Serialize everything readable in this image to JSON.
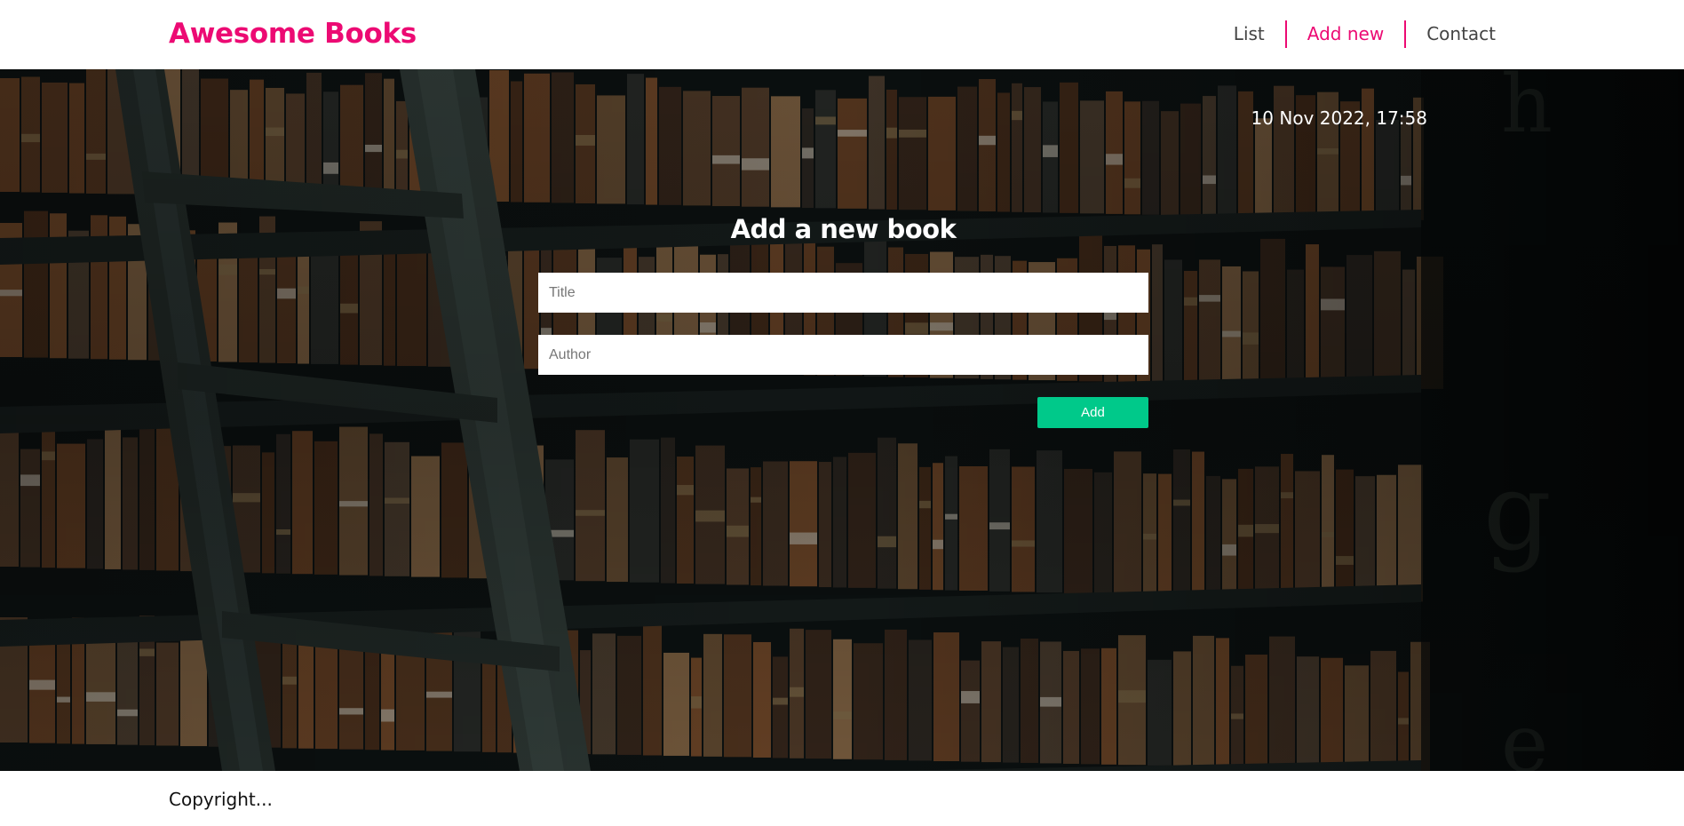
{
  "header": {
    "logo": "Awesome Books",
    "nav": {
      "list": "List",
      "add_new": "Add new",
      "contact": "Contact"
    }
  },
  "hero": {
    "datetime": "10 Nov 2022, 17:58",
    "form": {
      "heading": "Add a new book",
      "title_placeholder": "Title",
      "author_placeholder": "Author",
      "add_label": "Add"
    }
  },
  "footer": {
    "copyright": "Copyright..."
  },
  "colors": {
    "accent": "#ec0a73",
    "button": "#00c98a",
    "background_dark": "#0c1111"
  }
}
